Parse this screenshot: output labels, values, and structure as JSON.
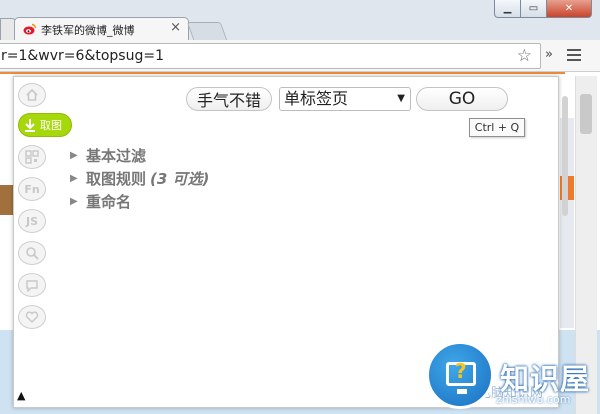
{
  "browser": {
    "tab_title": "李铁军的微博_微博",
    "tab_close": "×",
    "address": "r=1&wvr=6&topsug=1",
    "star": "☆",
    "overflow": "»",
    "window_buttons": {
      "minimize": "▁",
      "maximize": "▭",
      "close": "✕"
    }
  },
  "popup": {
    "sidebar": [
      {
        "name": "home",
        "icon": "home-icon"
      },
      {
        "name": "capture",
        "icon": "download-arrow-icon",
        "label": "取图"
      },
      {
        "name": "qr",
        "icon": "qr-code-icon"
      },
      {
        "name": "fn",
        "icon": "fn-icon",
        "label": "Fn"
      },
      {
        "name": "js",
        "icon": "js-icon",
        "label": "JS"
      },
      {
        "name": "search",
        "icon": "search-icon"
      },
      {
        "name": "comment",
        "icon": "comment-icon"
      },
      {
        "name": "heart",
        "icon": "heart-icon"
      }
    ],
    "lucky_button": "手气不错",
    "select_value": "单标签页",
    "go_button": "GO",
    "tooltip": "Ctrl + Q",
    "tree": [
      {
        "label": "基本过滤",
        "hint": ""
      },
      {
        "label": "取图规则",
        "hint": "(3 可选)"
      },
      {
        "label": "重命名",
        "hint": ""
      }
    ],
    "bottom_arrow": "▲"
  },
  "watermark": {
    "title": "知识屋",
    "subtitle": "zhishiwu.com",
    "ghost": "电脑知识网"
  },
  "colors": {
    "accent_green": "#a6d80c",
    "page_accent_orange": "#f08a3c",
    "watermark_blue": "#1a6fc2"
  }
}
